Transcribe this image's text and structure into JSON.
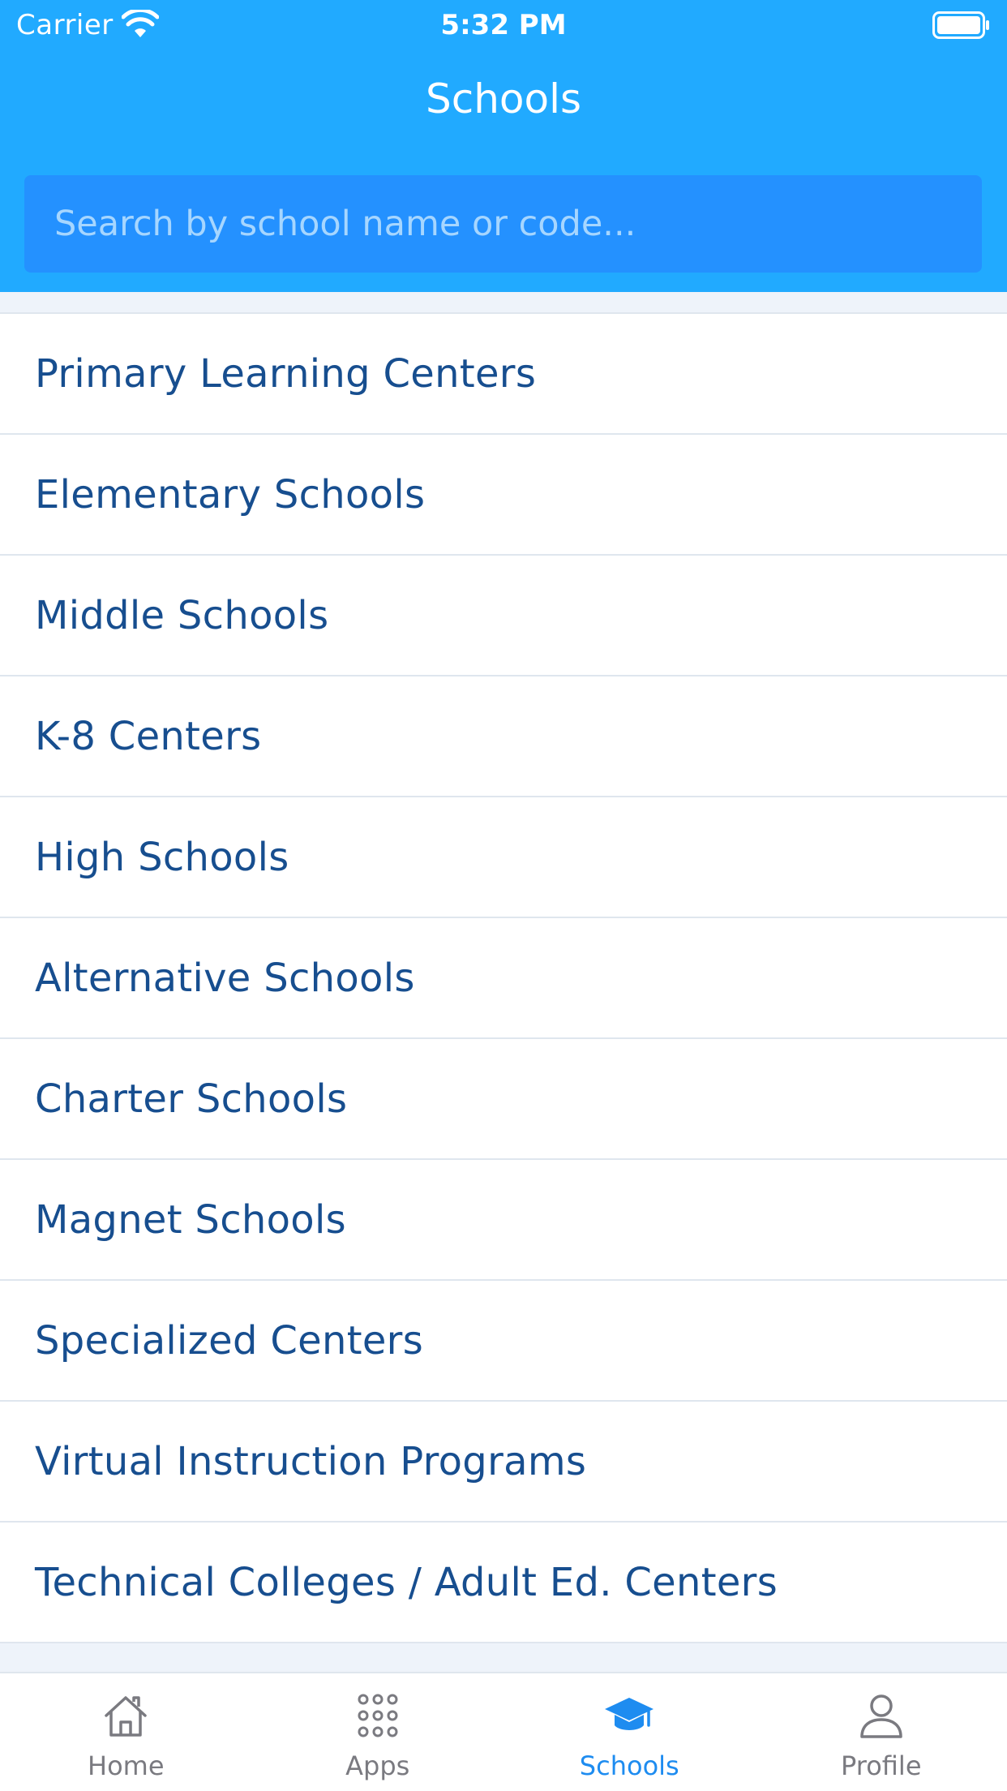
{
  "status_bar": {
    "carrier": "Carrier",
    "time": "5:32 PM"
  },
  "header": {
    "title": "Schools"
  },
  "search": {
    "placeholder": "Search by school name or code..."
  },
  "list": {
    "items": [
      "Primary Learning Centers",
      "Elementary Schools",
      "Middle Schools",
      "K-8 Centers",
      "High Schools",
      "Alternative Schools",
      "Charter Schools",
      "Magnet Schools",
      "Specialized Centers",
      "Virtual Instruction Programs",
      "Technical Colleges / Adult Ed. Centers"
    ]
  },
  "tab_bar": {
    "tabs": [
      {
        "label": "Home",
        "icon": "home-icon",
        "active": false
      },
      {
        "label": "Apps",
        "icon": "apps-grid-icon",
        "active": false
      },
      {
        "label": "Schools",
        "icon": "graduation-cap-icon",
        "active": true
      },
      {
        "label": "Profile",
        "icon": "person-icon",
        "active": false
      }
    ]
  },
  "colors": {
    "header_bg": "#21aaff",
    "search_bg": "#2491ff",
    "list_text": "#174e8f",
    "tab_active": "#1e8cf0",
    "tab_inactive": "#7a7a80"
  }
}
